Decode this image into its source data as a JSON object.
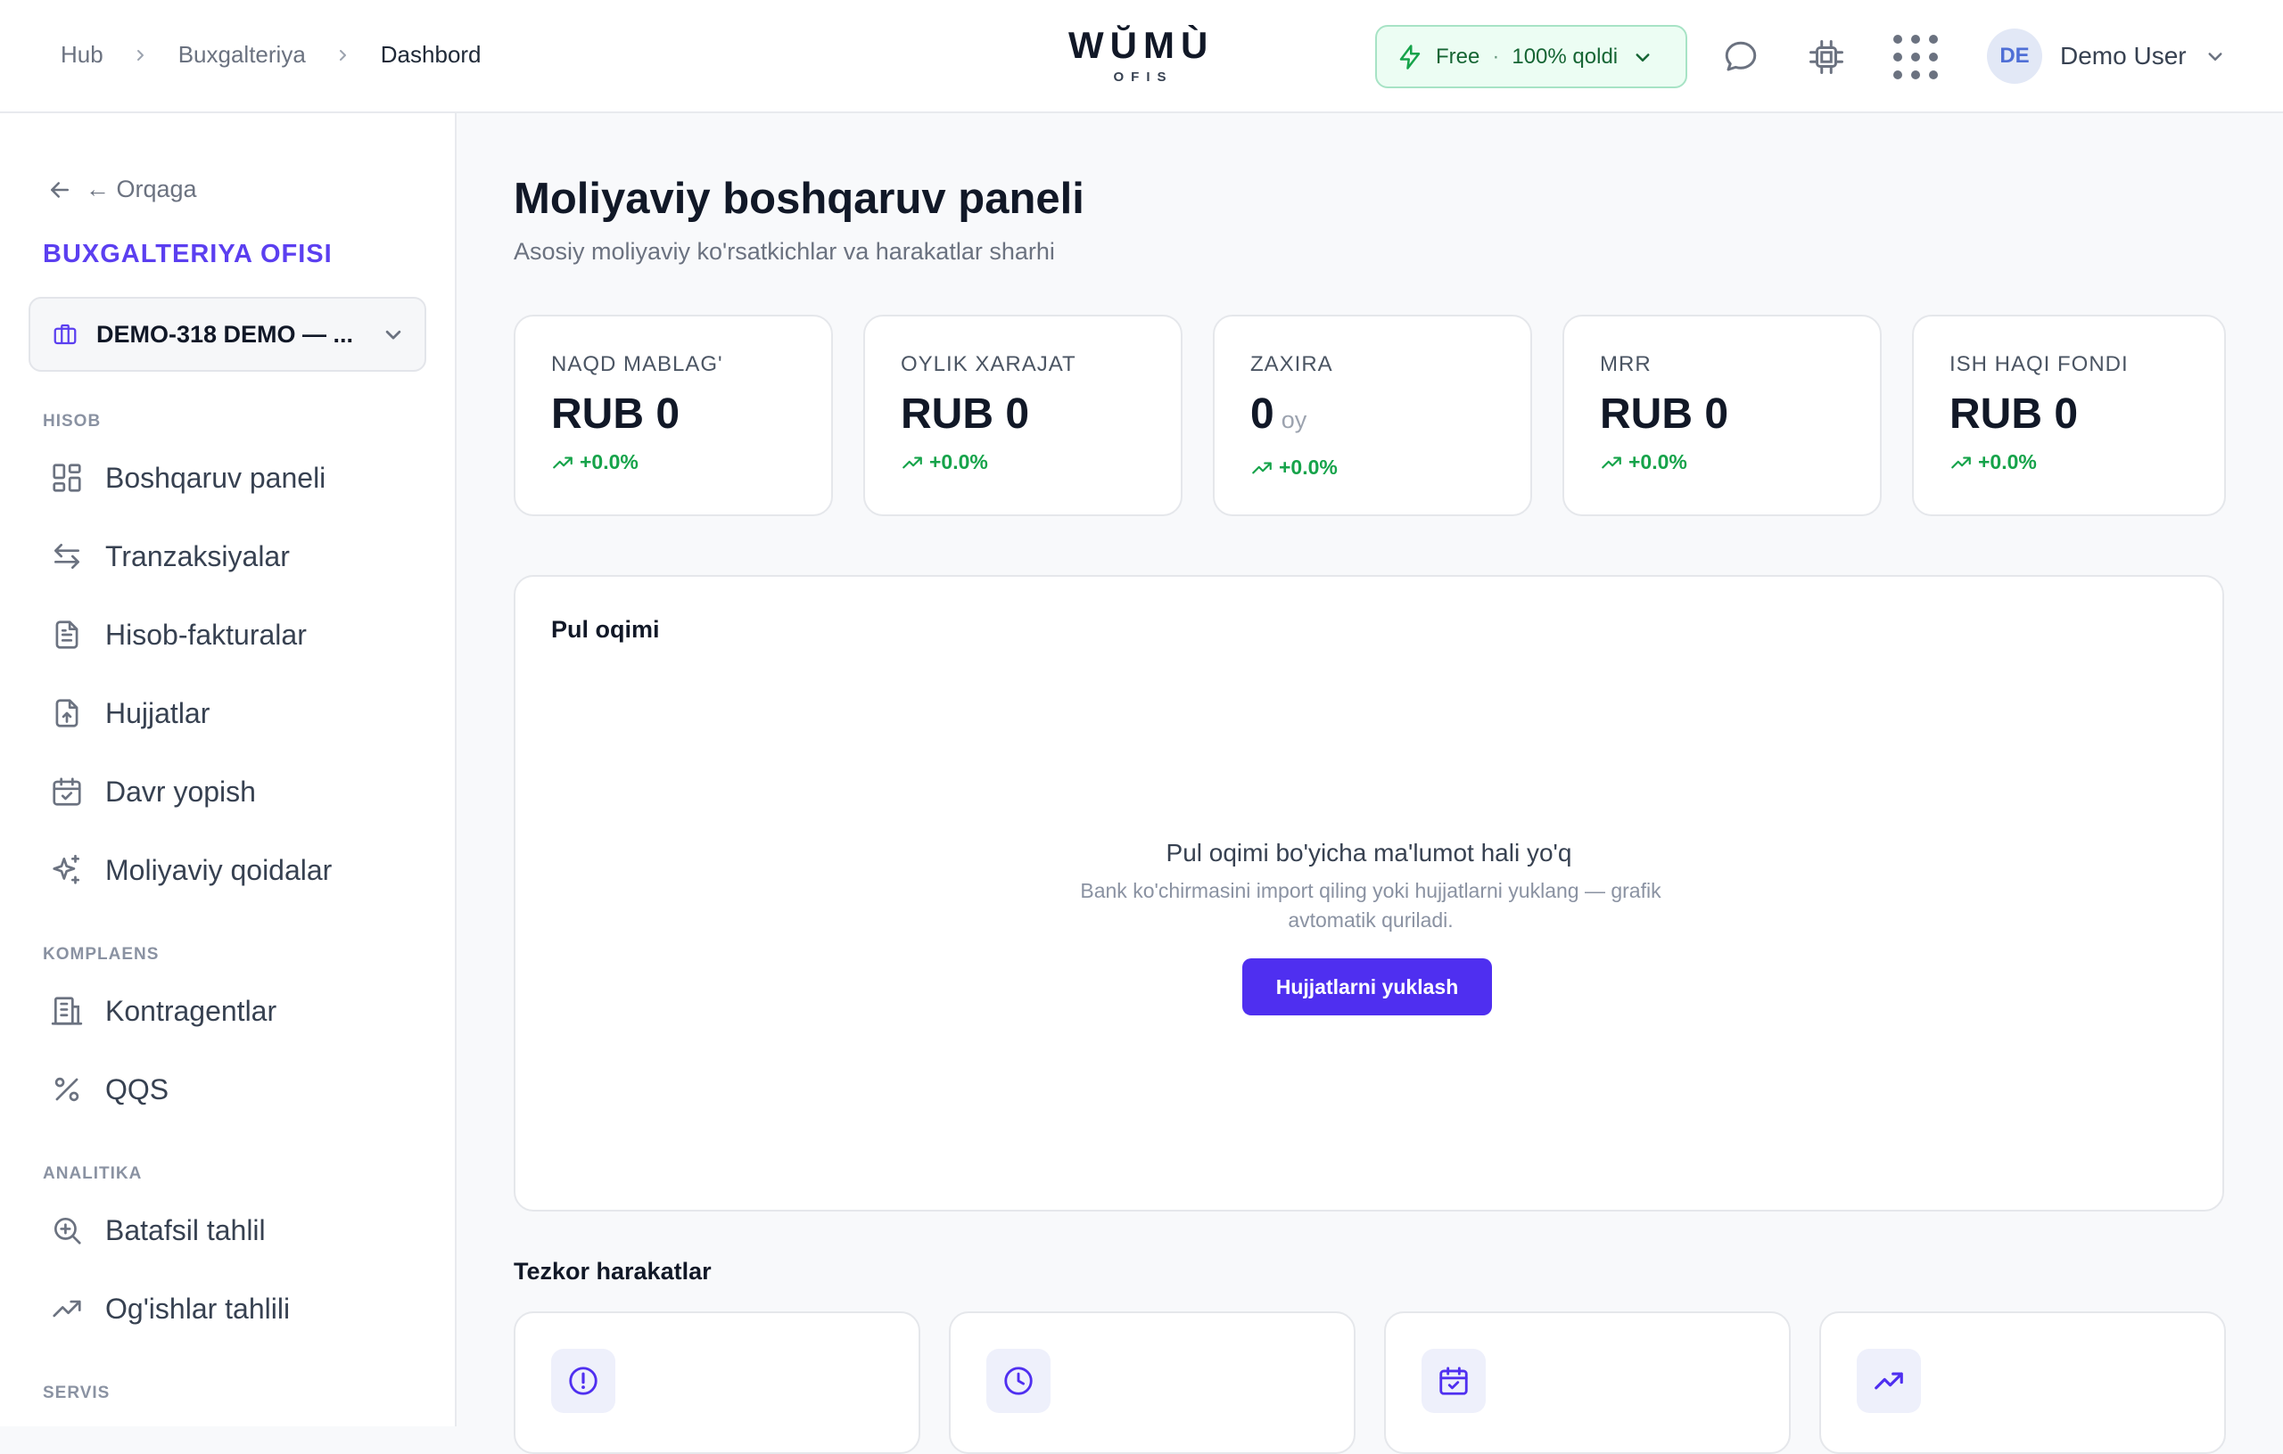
{
  "breadcrumb": [
    "Hub",
    "Buxgalteriya",
    "Dashbord"
  ],
  "logo": {
    "main": "WŬMÙ",
    "sub": "OFIS"
  },
  "plan": {
    "name": "Free",
    "separator": "·",
    "status": "100% qoldi"
  },
  "user": {
    "initials": "DE",
    "name": "Demo User"
  },
  "sidebar": {
    "back_label": "← Orqaga",
    "office_title": "BUXGALTERIYA OFISI",
    "org_name": "DEMO-318 DEMO — ...",
    "sections": {
      "hisob": "HISOB",
      "komplaens": "KOMPLAENS",
      "analitika": "ANALITIKA",
      "servis": "SERVIS"
    },
    "items": {
      "dashboard": "Boshqaruv paneli",
      "transactions": "Tranzaksiyalar",
      "invoices": "Hisob-fakturalar",
      "documents": "Hujjatlar",
      "close_period": "Davr yopish",
      "rules": "Moliyaviy qoidalar",
      "counterparties": "Kontragentlar",
      "vat": "QQS",
      "analysis": "Batafsil tahlil",
      "deviations": "Og'ishlar tahlili"
    }
  },
  "main": {
    "title": "Moliyaviy boshqaruv paneli",
    "subtitle": "Asosiy moliyaviy ko'rsatkichlar va harakatlar sharhi",
    "stats": [
      {
        "label": "NAQD MABLAG'",
        "value": "RUB 0",
        "change": "+0.0%"
      },
      {
        "label": "OYLIK XARAJAT",
        "value": "RUB 0",
        "change": "+0.0%"
      },
      {
        "label": "ZAXIRA",
        "value": "0",
        "unit": "oy",
        "change": "+0.0%"
      },
      {
        "label": "MRR",
        "value": "RUB 0",
        "change": "+0.0%"
      },
      {
        "label": "ISH HAQI FONDI",
        "value": "RUB 0",
        "change": "+0.0%"
      }
    ],
    "cashflow": {
      "title": "Pul oqimi",
      "empty_title": "Pul oqimi bo'yicha ma'lumot hali yo'q",
      "empty_desc": "Bank ko'chirmasini import qiling yoki hujjatlarni yuklang — grafik avtomatik quriladi.",
      "button": "Hujjatlarni yuklash"
    },
    "quick_title": "Tezkor harakatlar"
  },
  "colors": {
    "accent": "#5b3ff0",
    "button": "#4f2ff0",
    "positive": "#16a34a",
    "plan_bg": "#ecfdf3"
  }
}
